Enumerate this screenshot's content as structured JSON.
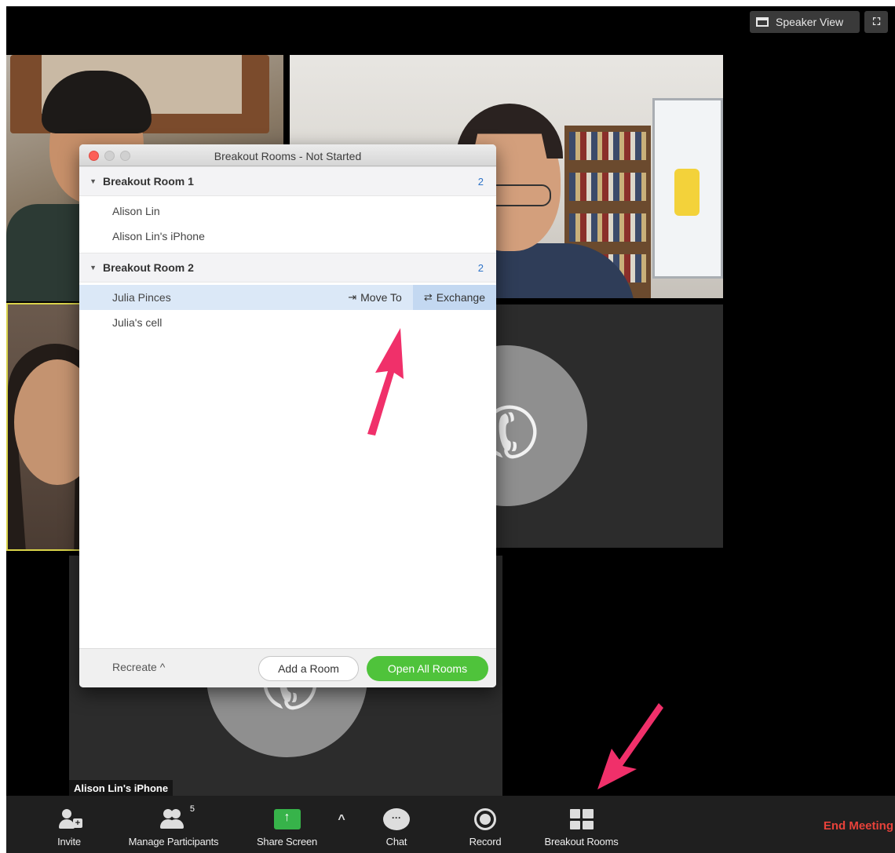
{
  "top_bar": {
    "speaker_view_label": "Speaker View"
  },
  "name_label": "Alison Lin's iPhone",
  "dialog": {
    "title": "Breakout Rooms - Not Started",
    "rooms": [
      {
        "name": "Breakout Room 1",
        "count": "2",
        "members": [
          "Alison Lin",
          "Alison Lin's iPhone"
        ]
      },
      {
        "name": "Breakout Room 2",
        "count": "2",
        "members": [
          "Julia Pinces",
          "Julia's cell"
        ]
      }
    ],
    "row_actions": {
      "move_to": "Move To",
      "exchange": "Exchange"
    },
    "footer": {
      "recreate": "Recreate",
      "add_room": "Add a Room",
      "open_all": "Open All Rooms"
    }
  },
  "toolbar": {
    "invite": "Invite",
    "manage_participants": "Manage Participants",
    "participant_count": "5",
    "share_screen": "Share Screen",
    "chat": "Chat",
    "record": "Record",
    "breakout_rooms": "Breakout Rooms",
    "end_meeting": "End Meeting"
  },
  "icons": {
    "speaker_view": "speaker-view-icon",
    "fullscreen": "fullscreen-icon",
    "move_to": "move-to-icon",
    "exchange": "exchange-icon",
    "annotation_arrow_color": "#f0306a",
    "accent_green": "#4fc33b",
    "end_meeting_color": "#e8423a"
  }
}
